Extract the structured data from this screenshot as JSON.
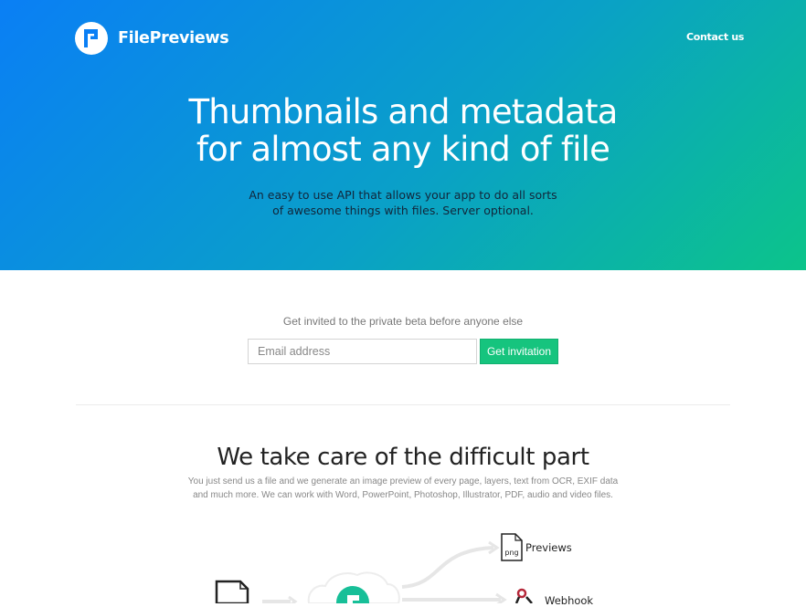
{
  "brand": {
    "name": "FilePreviews"
  },
  "nav": {
    "contact_label": "Contact us"
  },
  "hero": {
    "headline_line1": "Thumbnails and metadata",
    "headline_line2": "for almost any kind of file",
    "subtitle_line1": "An easy to use API that allows your app to do all sorts",
    "subtitle_line2": "of awesome things with files. Server optional."
  },
  "signup": {
    "prompt": "Get invited to the private beta before anyone else",
    "email_placeholder": "Email address",
    "button_label": "Get invitation"
  },
  "features": {
    "title": "We take care of the difficult part",
    "desc_line1": "You just send us a file and we generate an image preview of every page, layers, text from OCR, EXIF data",
    "desc_line2": "and much more. We can work with Word, PowerPoint, Photoshop, Illustrator, PDF, audio and video files."
  },
  "diagram": {
    "file_ext": "png",
    "output_previews": "Previews",
    "output_webhook": "Webhook"
  },
  "colors": {
    "gradient_start": "#0a7ff5",
    "gradient_end": "#0cc48a",
    "accent_green": "#16c47e"
  },
  "icons": [
    "logo-f-icon",
    "document-icon",
    "png-file-icon",
    "webhook-icon",
    "cloud-icon",
    "arrow-icon"
  ]
}
